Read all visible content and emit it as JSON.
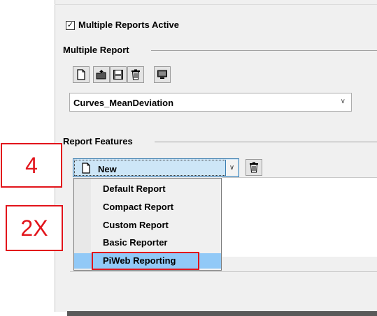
{
  "settings": {
    "multiple_active_label": "Multiple Reports Active",
    "multiple_active_checked": true,
    "check_glyph": "✓",
    "multiple_report_group": "Multiple Report",
    "multiple_report_value": "Curves_MeanDeviation",
    "toolbar_icons": [
      "new-document-icon",
      "open-folder-icon",
      "save-icon",
      "delete-icon",
      "monitor-icon"
    ],
    "report_features_group": "Report Features",
    "features_value": "New",
    "dropdown_arrow": "∨"
  },
  "dropdown": {
    "items": [
      "Default Report",
      "Compact Report",
      "Custom Report",
      "Basic Reporter",
      "PiWeb Reporting"
    ],
    "selected_index": 4,
    "selected_color": "#91c9f7"
  },
  "annotations": {
    "step_label": "4",
    "action_label": "2X",
    "color": "#e2141b"
  }
}
